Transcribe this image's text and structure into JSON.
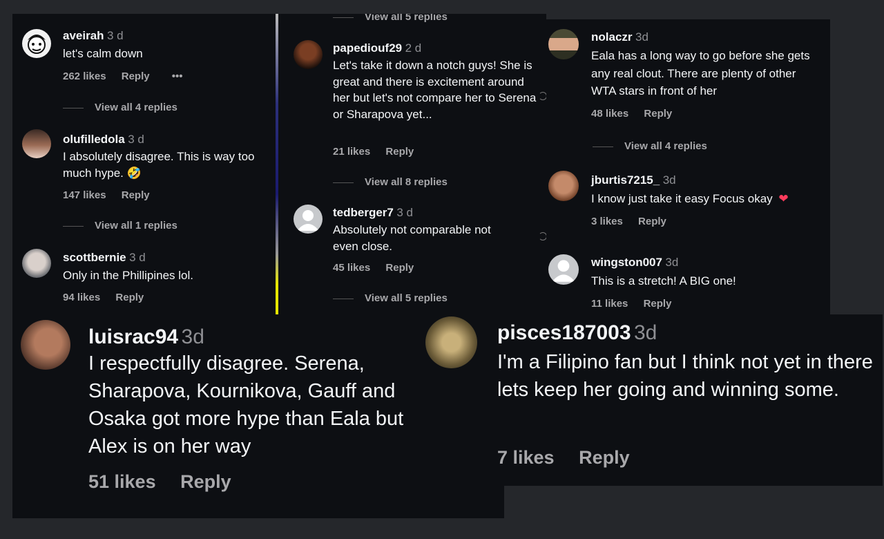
{
  "panel1": {
    "c1": {
      "user": "aveirah",
      "time": "3 d",
      "text": "let's calm down",
      "likes": "262 likes",
      "reply": "Reply",
      "more": "•••"
    },
    "r1": "View all 4 replies",
    "c2": {
      "user": "olufilledola",
      "time": "3 d",
      "text": "I absolutely disagree. This is way too much hype. 🤣",
      "likes": "147 likes",
      "reply": "Reply"
    },
    "r2": "View all 1 replies",
    "c3": {
      "user": "scottbernie",
      "time": "3 d",
      "text": "Only in the Phillipines lol.",
      "likes": "94 likes",
      "reply": "Reply"
    }
  },
  "panel2": {
    "r0": "View all 5 replies",
    "c1": {
      "user": "papediouf29",
      "time": "2 d",
      "text": "Let's take it down a notch guys! She is great and there is excitement around her but let's not compare her to Serena or Sharapova yet...",
      "likes": "21 likes",
      "reply": "Reply"
    },
    "r1": "View all 8 replies",
    "c2": {
      "user": "tedberger7",
      "time": "3 d",
      "text": "Absolutely not comparable not even close.",
      "likes": "45 likes",
      "reply": "Reply"
    },
    "r2": "View all 5 replies"
  },
  "panel3": {
    "c1": {
      "user": "nolaczr",
      "time": "3d",
      "text": "Eala has a long way to go before she gets any real clout. There are plenty of other WTA stars in front of her",
      "likes": "48 likes",
      "reply": "Reply"
    },
    "r1": "View all 4 replies",
    "c2": {
      "user": "jburtis7215_",
      "time": "3d",
      "text": "I know just take it easy Focus okay",
      "emoji": "❤",
      "likes": "3 likes",
      "reply": "Reply"
    },
    "c3": {
      "user": "wingston007",
      "time": "3d",
      "text": "This is a stretch! A BIG one!",
      "likes": "11 likes",
      "reply": "Reply"
    }
  },
  "panel4": {
    "c1": {
      "user": "luisrac94",
      "time": "3d",
      "text": "I respectfully disagree. Serena, Sharapova, Kournikova, Gauff and Osaka got more hype than Eala but Alex is on her way",
      "likes": "51 likes",
      "reply": "Reply"
    }
  },
  "panel5": {
    "c1": {
      "user": "pisces187003",
      "time": "3d",
      "text": "I'm a Filipino fan but I think not yet in there lets keep her going and winning some.",
      "likes": "7 likes",
      "reply": "Reply"
    }
  },
  "colors": {
    "page_bg": "#25272b",
    "panel_bg": "#0d0f13",
    "text": "#f3f5f7",
    "secondary": "#a8a8ab",
    "heart": "#ff3b5c",
    "scroll_accent": "#e6e600"
  }
}
